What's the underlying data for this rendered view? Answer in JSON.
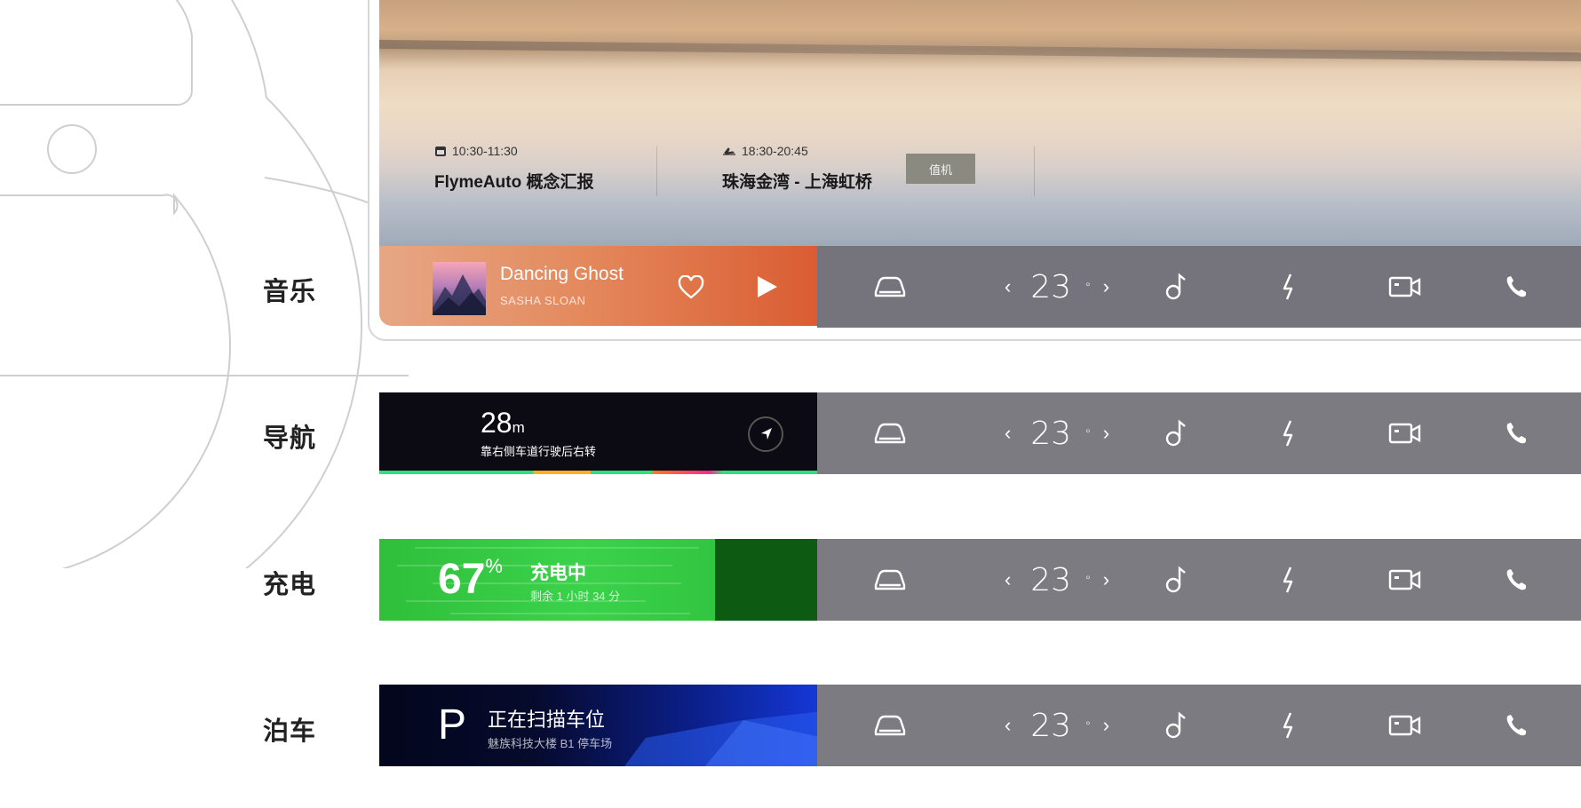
{
  "rows": {
    "music": "音乐",
    "nav": "导航",
    "charge": "充电",
    "park": "泊车"
  },
  "schedule": {
    "event1": {
      "time": "10:30-11:30",
      "title": "FlymeAuto 概念汇报",
      "icon": "calendar-icon"
    },
    "event2": {
      "time": "18:30-20:45",
      "title": "珠海金湾 - 上海虹桥",
      "icon": "plane-icon",
      "action": "值机"
    }
  },
  "music": {
    "song": "Dancing Ghost",
    "artist": "SASHA SLOAN"
  },
  "navigation": {
    "distance": "28",
    "unit": "m",
    "instruction": "靠右侧车道行驶后右转"
  },
  "charging": {
    "percent": "67",
    "percent_sign": "%",
    "status": "充电中",
    "remaining": "剩余 1 小时 34 分",
    "level": 0.67,
    "accent": "#3bd24a"
  },
  "parking": {
    "letter": "P",
    "status": "正在扫描车位",
    "location": "魅族科技大楼 B1 停车场"
  },
  "controls": {
    "temp": "23",
    "deg": "°",
    "prev": "‹",
    "next": "›",
    "icons": [
      "car-icon",
      "music-note-icon",
      "bolt-icon",
      "camera-icon",
      "phone-icon"
    ]
  }
}
